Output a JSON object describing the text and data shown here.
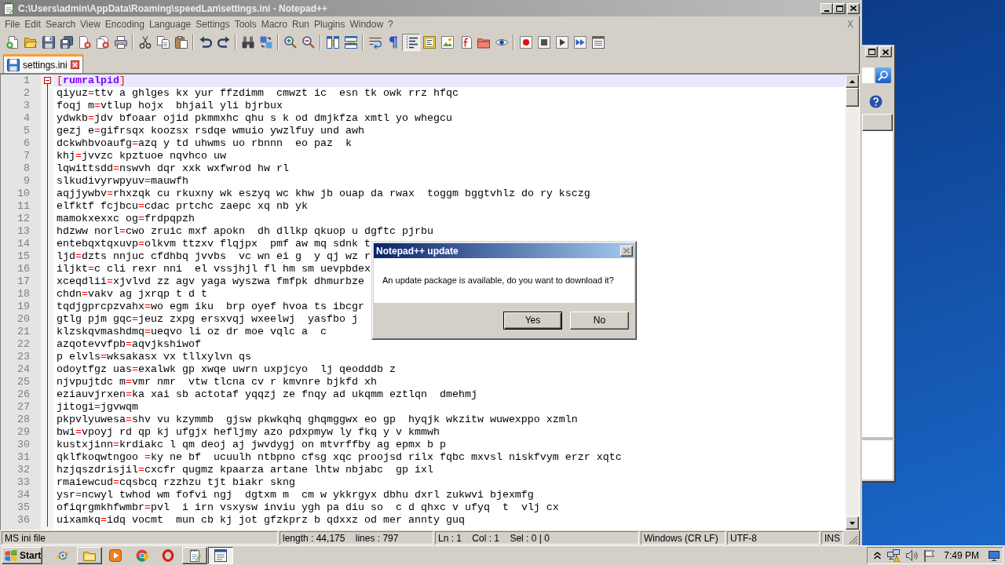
{
  "window": {
    "title": "C:\\Users\\admin\\AppData\\Roaming\\speedLan\\settings.ini - Notepad++",
    "active": false
  },
  "menu": [
    "File",
    "Edit",
    "Search",
    "View",
    "Encoding",
    "Language",
    "Settings",
    "Tools",
    "Macro",
    "Run",
    "Plugins",
    "Window",
    "?"
  ],
  "close_document": "X",
  "toolbar": [
    {
      "kind": "button",
      "pressed": false
    },
    {
      "kind": "button",
      "pressed": false
    },
    {
      "kind": "button",
      "pressed": false
    },
    {
      "kind": "button",
      "pressed": false
    },
    {
      "kind": "button",
      "pressed": false
    },
    {
      "kind": "button",
      "pressed": false
    },
    {
      "kind": "button",
      "pressed": false
    },
    {
      "kind": "separator"
    },
    {
      "kind": "button",
      "pressed": false
    },
    {
      "kind": "button",
      "pressed": false
    },
    {
      "kind": "button",
      "pressed": false
    },
    {
      "kind": "separator"
    },
    {
      "kind": "button",
      "pressed": false
    },
    {
      "kind": "button",
      "pressed": false
    },
    {
      "kind": "separator"
    },
    {
      "kind": "button",
      "pressed": false
    },
    {
      "kind": "button",
      "pressed": false
    },
    {
      "kind": "separator"
    },
    {
      "kind": "button",
      "pressed": false
    },
    {
      "kind": "button",
      "pressed": false
    },
    {
      "kind": "separator"
    },
    {
      "kind": "button",
      "pressed": false
    },
    {
      "kind": "button",
      "pressed": false
    },
    {
      "kind": "separator"
    },
    {
      "kind": "button",
      "pressed": false
    },
    {
      "kind": "button",
      "pressed": false
    },
    {
      "kind": "button",
      "pressed": true
    },
    {
      "kind": "button",
      "pressed": false
    },
    {
      "kind": "button",
      "pressed": false
    },
    {
      "kind": "button",
      "pressed": false
    },
    {
      "kind": "button",
      "pressed": false
    },
    {
      "kind": "button",
      "pressed": false
    },
    {
      "kind": "separator"
    },
    {
      "kind": "button",
      "pressed": false
    },
    {
      "kind": "button",
      "pressed": false
    },
    {
      "kind": "button",
      "pressed": false
    },
    {
      "kind": "button",
      "pressed": false
    },
    {
      "kind": "button",
      "pressed": false
    }
  ],
  "tabs": [
    {
      "label": "settings.ini",
      "selected": true
    }
  ],
  "lines": [
    {
      "number": "1",
      "kind": "section",
      "open": "[",
      "name": "rumralpid",
      "close": "]",
      "expanded": true,
      "current": true
    },
    {
      "number": "2",
      "kind": "pair",
      "key": "qiyuz",
      "operator": "=",
      "value": "ttv a ghlges kx yur ffzdimm  cmwzt ic  esn tk owk rrz hfqc",
      "current": false
    },
    {
      "number": "3",
      "kind": "pair",
      "key": "foqj m",
      "operator": "=",
      "value": "vtlup hojx  bhjail yli bjrbux",
      "current": false
    },
    {
      "number": "4",
      "kind": "pair",
      "key": "ydwkb",
      "operator": "=",
      "value": "jdv bfoaar ojid pkmmxhc qhu s k od dmjkfza xmtl yo whegcu",
      "current": false
    },
    {
      "number": "5",
      "kind": "pair",
      "key": "gezj e",
      "operator": "=",
      "value": "gifrsqx koozsx rsdqe wmuio ywzlfuy und awh",
      "current": false
    },
    {
      "number": "6",
      "kind": "pair",
      "key": "dckwhbvoaufg",
      "operator": "=",
      "value": "azq y td uhwms uo rbnnn  eo paz  k",
      "current": false
    },
    {
      "number": "7",
      "kind": "pair",
      "key": "khj",
      "operator": "=",
      "value": "jvvzc kpztuoe nqvhco uw",
      "current": false
    },
    {
      "number": "8",
      "kind": "pair",
      "key": "lqwittsdd",
      "operator": "=",
      "value": "nswvh dqr xxk wxfwrod hw rl",
      "current": false
    },
    {
      "number": "9",
      "kind": "pair",
      "key": "slkudivyrwpyuv",
      "operator": "=",
      "value": "mauwfh",
      "current": false
    },
    {
      "number": "10",
      "kind": "pair",
      "key": "aqjjywbv",
      "operator": "=",
      "value": "rhxzqk cu rkuxny wk eszyq wc khw jb ouap da rwax  toggm bggtvhlz do ry ksczg",
      "current": false
    },
    {
      "number": "11",
      "kind": "pair",
      "key": "elfktf fcjbcu",
      "operator": "=",
      "value": "cdac prtchc zaepc xq nb yk",
      "current": false
    },
    {
      "number": "12",
      "kind": "pair",
      "key": "mamokxexxc og",
      "operator": "=",
      "value": "frdpqpzh",
      "current": false
    },
    {
      "number": "13",
      "kind": "pair",
      "key": "hdzww norl",
      "operator": "=",
      "value": "cwo zruic mxf apokn  dh dllkp qkuop u dgftc pjrbu",
      "current": false
    },
    {
      "number": "14",
      "kind": "pair",
      "key": "entebqxtqxuvp",
      "operator": "=",
      "value": "olkvm ttzxv flqjpx  pmf aw mq sdnk t",
      "current": false
    },
    {
      "number": "15",
      "kind": "pair",
      "key": "ljd",
      "operator": "=",
      "value": "dzts nnjuc cfdhbq jvvbs  vc wn ei g  y qj wz r",
      "current": false
    },
    {
      "number": "16",
      "kind": "pair",
      "key": "iljkt",
      "operator": "=",
      "value": "c cli rexr nni  el vssjhjl fl hm sm uevpbdex",
      "current": false
    },
    {
      "number": "17",
      "kind": "pair",
      "key": "xceqdlii",
      "operator": "=",
      "value": "xjvlvd zz agv yaga wyszwa fmfpk dhmurbze",
      "current": false
    },
    {
      "number": "18",
      "kind": "pair",
      "key": "chdn",
      "operator": "=",
      "value": "vakv ag jxrqp t d t",
      "current": false
    },
    {
      "number": "19",
      "kind": "pair",
      "key": "tqdjgprcpzvahx",
      "operator": "=",
      "value": "wo egm iku  brp oyef hvoa ts ibcgr",
      "current": false
    },
    {
      "number": "20",
      "kind": "pair",
      "key": "gtlg pjm gqc",
      "operator": "=",
      "value": "jeuz zxpg ersxvqj wxeelwj  yasfbo j",
      "current": false
    },
    {
      "number": "21",
      "kind": "pair",
      "key": "klzskqvmashdmq",
      "operator": "=",
      "value": "ueqvo li oz dr moe vqlc a  c",
      "current": false
    },
    {
      "number": "22",
      "kind": "pair",
      "key": "azqotevvfpb",
      "operator": "=",
      "value": "aqvjkshiwof",
      "current": false
    },
    {
      "number": "23",
      "kind": "pair",
      "key": "p elvls",
      "operator": "=",
      "value": "wksakasx vx tllxylvn qs",
      "current": false
    },
    {
      "number": "24",
      "kind": "pair",
      "key": "odoytfgz uas",
      "operator": "=",
      "value": "exalwk gp xwqe uwrn uxpjcyo  lj qeodddb z",
      "current": false
    },
    {
      "number": "25",
      "kind": "pair",
      "key": "njvpujtdc m",
      "operator": "=",
      "value": "vmr nmr  vtw tlcna cv r kmvnre bjkfd xh",
      "current": false
    },
    {
      "number": "26",
      "kind": "pair",
      "key": "eziauvjrxen",
      "operator": "=",
      "value": "ka xai sb actotaf yqqzj ze fnqy ad ukqmm eztlqn  dmehmj",
      "current": false
    },
    {
      "number": "27",
      "kind": "pair",
      "key": "jitogi",
      "operator": "=",
      "value": "jgvwqm",
      "current": false
    },
    {
      "number": "28",
      "kind": "pair",
      "key": "pkpvlyuwesa",
      "operator": "=",
      "value": "shv vu kzymmb  gjsw pkwkqhq ghqmggwx eo gp  hyqjk wkzitw wuwexppo xzmln",
      "current": false
    },
    {
      "number": "29",
      "kind": "pair",
      "key": "bwi",
      "operator": "=",
      "value": "vpoyj rd qp kj ufgjx hefljmy azo pdxpmyw ly fkq y v kmmwh",
      "current": false
    },
    {
      "number": "30",
      "kind": "pair",
      "key": "kustxjinn",
      "operator": "=",
      "value": "krdiakc l qm deoj aj jwvdygj on mtvrffby ag epmx b p",
      "current": false
    },
    {
      "number": "31",
      "kind": "pair",
      "key": "qklfkoqwtngoo ",
      "operator": "=",
      "value": "ky ne bf  ucuulh ntbpno cfsg xqc proojsd rilx fqbc mxvsl niskfvym erzr xqtc",
      "current": false
    },
    {
      "number": "32",
      "kind": "pair",
      "key": "hzjqszdrisjil",
      "operator": "=",
      "value": "cxcfr qugmz kpaarza artane lhtw nbjabc  gp ixl",
      "current": false
    },
    {
      "number": "33",
      "kind": "pair",
      "key": "rmaiewcud",
      "operator": "=",
      "value": "cqsbcq rzzhzu tjt biakr skng",
      "current": false
    },
    {
      "number": "34",
      "kind": "pair",
      "key": "ysr",
      "operator": "=",
      "value": "ncwyl twhod wm fofvi ngj  dgtxm m  cm w ykkrgyx dbhu dxrl zukwvi bjexmfg",
      "current": false
    },
    {
      "number": "35",
      "kind": "pair",
      "key": "ofiqrgmkhfwmbr",
      "operator": "=",
      "value": "pvl  i irn vsxysw inviu ygh pa diu so  c d qhxc v ufyq  t  vlj cx",
      "current": false
    },
    {
      "number": "36",
      "kind": "pair",
      "key": "uixamkq",
      "operator": "=",
      "value": "idq vocmt  mun cb kj jot gfzkprz b qdxxz od mer annty guq",
      "current": false
    }
  ],
  "status_bar": [
    "MS ini file",
    "length : 44,175    lines : 797",
    "Ln : 1    Col : 1    Sel : 0 | 0",
    "Windows (CR LF)",
    "UTF-8",
    "INS"
  ],
  "dialog": {
    "title": "Notepad++ update",
    "active": true,
    "close_disabled": true,
    "message": "An update package is available, do you want to download it?",
    "buttons": [
      {
        "label": "Yes",
        "default": true
      },
      {
        "label": "No",
        "default": false
      }
    ]
  },
  "taskbar": {
    "start": "Start",
    "apps": [
      {
        "open": false,
        "pressed": false
      },
      {
        "open": true,
        "pressed": false
      },
      {
        "open": false,
        "pressed": false
      },
      {
        "open": false,
        "pressed": false
      },
      {
        "open": false,
        "pressed": false
      },
      {
        "open": true,
        "pressed": false
      },
      {
        "open": true,
        "pressed": true
      }
    ],
    "clock": "7:49 PM"
  }
}
